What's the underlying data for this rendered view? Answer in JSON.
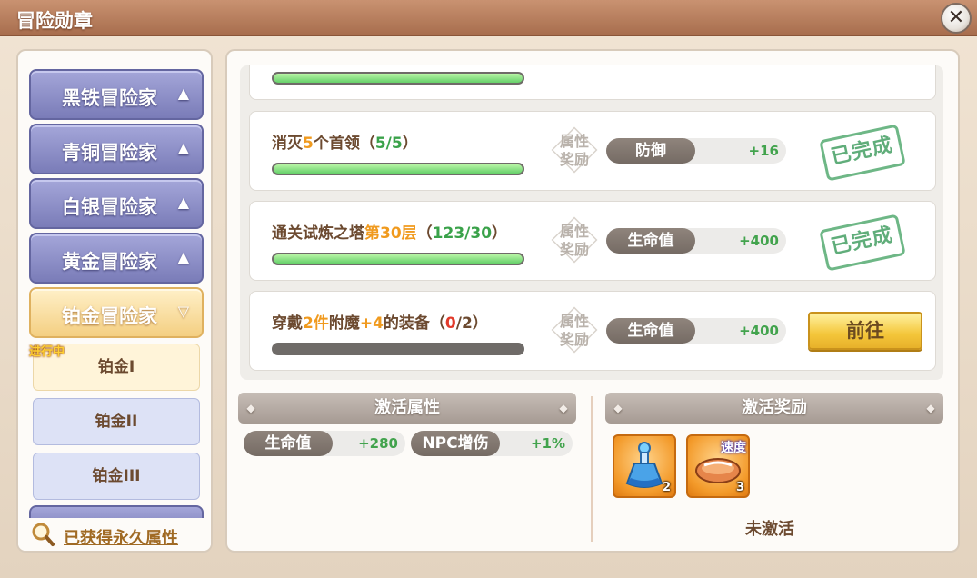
{
  "window": {
    "title": "冒险勋章",
    "close_label": "✕"
  },
  "sidebar": {
    "tiers": [
      {
        "label": "黑铁冒险家",
        "arrow": "▲"
      },
      {
        "label": "青铜冒险家",
        "arrow": "▲"
      },
      {
        "label": "白银冒险家",
        "arrow": "▲"
      },
      {
        "label": "黄金冒险家",
        "arrow": "▲"
      },
      {
        "label": "铂金冒险家",
        "arrow": "▽"
      }
    ],
    "sub_levels": [
      "铂金I",
      "铂金II",
      "铂金III"
    ],
    "in_progress_label": "进行中",
    "permanent_link": "已获得永久属性"
  },
  "tasks": [
    {
      "title_parts": [
        "消灭",
        "5",
        "个首领（",
        "5/5",
        "）"
      ],
      "progress": 1.0,
      "reward_tag": [
        "属性",
        "奖励"
      ],
      "attr_name": "防御",
      "attr_value": "+16",
      "status": "已完成"
    },
    {
      "title_parts": [
        "通关试炼之塔",
        "第30层",
        "（",
        "123/30",
        "）"
      ],
      "progress": 1.0,
      "reward_tag": [
        "属性",
        "奖励"
      ],
      "attr_name": "生命值",
      "attr_value": "+400",
      "status": "已完成"
    },
    {
      "title_parts": [
        "穿戴",
        "2件",
        "附魔",
        "+4",
        "的装备（",
        "0",
        "/2）"
      ],
      "progress": 0.0,
      "reward_tag": [
        "属性",
        "奖励"
      ],
      "attr_name": "生命值",
      "attr_value": "+400",
      "button": "前往"
    }
  ],
  "activation_attrs": {
    "header": "激活属性",
    "stats": [
      {
        "name": "生命值",
        "value": "+280"
      },
      {
        "name": "NPC增伤",
        "value": "+1%"
      }
    ]
  },
  "activation_rewards": {
    "header": "激活奖励",
    "items": [
      {
        "icon": "potion-bottle-icon",
        "count": "2"
      },
      {
        "icon": "bread-icon",
        "count": "3",
        "badge": "速度"
      }
    ],
    "status": "未激活"
  },
  "colors": {
    "progress_fill": "#66d06a",
    "highlight_orange": "#f09a1e",
    "value_green": "#42a34d",
    "tier_purple": "#7a7cb8",
    "tier_active_gold": "#f4cf82"
  }
}
